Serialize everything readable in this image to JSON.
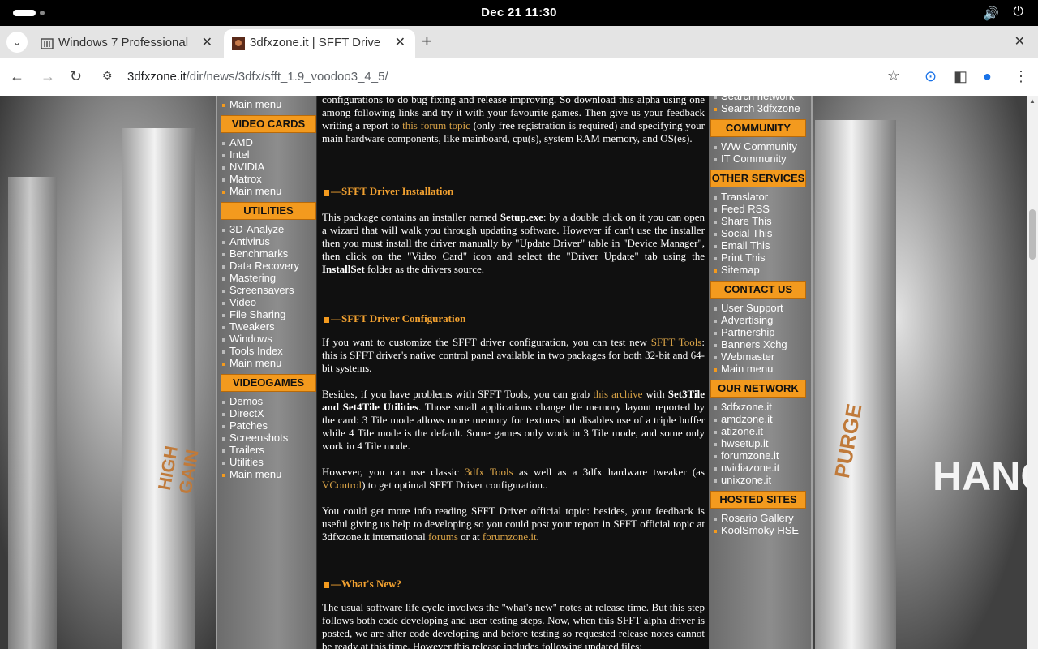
{
  "system": {
    "clock": "Dec 21  11:30",
    "volume_icon": "🔊",
    "power_icon": "⏻"
  },
  "tabs": [
    {
      "title": "Windows 7 Professional",
      "active": false
    },
    {
      "title": "3dfxzone.it | SFFT Driver",
      "active": true
    }
  ],
  "address": {
    "domain": "3dfxzone.it",
    "path": "/dir/news/3dfx/sfft_1.9_voodoo3_4_5/"
  },
  "left_menu": {
    "top_item": "Main menu",
    "sections": [
      {
        "header": "VIDEO CARDS",
        "items": [
          "AMD",
          "Intel",
          "NVIDIA",
          "Matrox",
          "Main menu"
        ]
      },
      {
        "header": "UTILITIES",
        "items": [
          "3D-Analyze",
          "Antivirus",
          "Benchmarks",
          "Data Recovery",
          "Mastering",
          "Screensavers",
          "Video",
          "File Sharing",
          "Tweakers",
          "Windows",
          "Tools Index",
          "Main menu"
        ]
      },
      {
        "header": "VIDEOGAMES",
        "items": [
          "Demos",
          "DirectX",
          "Patches",
          "Screenshots",
          "Trailers",
          "Utilities",
          "Main menu"
        ]
      }
    ]
  },
  "right_menu": {
    "top_items": [
      "Search network",
      "Search 3dfxzone"
    ],
    "sections": [
      {
        "header": "COMMUNITY",
        "items": [
          "WW Community",
          "IT Community"
        ]
      },
      {
        "header": "OTHER SERVICES",
        "items": [
          "Translator",
          "Feed RSS",
          "Share This",
          "Social This",
          "Email This",
          "Print This",
          "Sitemap"
        ]
      },
      {
        "header": "CONTACT US",
        "items": [
          "User Support",
          "Advertising",
          "Partnership",
          "Banners Xchg",
          "Webmaster",
          "Main menu"
        ]
      },
      {
        "header": "OUR NETWORK",
        "items": [
          "3dfxzone.it",
          "amdzone.it",
          "atizone.it",
          "hwsetup.it",
          "forumzone.it",
          "nvidiazone.it",
          "unixzone.it"
        ]
      },
      {
        "header": "HOSTED SITES",
        "items": [
          "Rosario Gallery",
          "KoolSmoky HSE"
        ]
      }
    ]
  },
  "article": {
    "intro_a": "configurations to do bug fixing and release improving. So download this alpha using one among following links and try it with your favourite games. Then give us your feedback writing a report to ",
    "intro_link": "this forum topic",
    "intro_b": " (only free registration is required) and specifying your main hardware components, like mainboard, cpu(s), system RAM memory, and OS(es).",
    "install_title": "SFFT Driver Installation",
    "install_a": "This package contains an installer named ",
    "install_setup": "Setup.exe",
    "install_b": ": by a double click on it you can open a wizard that will walk you through updating software. However if can't use the installer then you must install the driver manually by \"Update Driver\" table in \"Device Manager\", then click on the \"Video Card\" icon and select the \"Driver Update\" tab using the ",
    "install_set": "InstallSet",
    "install_c": " folder as the drivers source.",
    "config_title": "SFFT Driver Configuration",
    "config1_a": "If you want to customize the SFFT driver configuration, you can test new ",
    "config1_link": "SFFT Tools",
    "config1_b": ": this is SFFT driver's native control panel available in two packages for both 32-bit and 64-bit systems.",
    "config2_a": "Besides, if you have problems with SFFT Tools, you can grab ",
    "config2_link": "this archive",
    "config2_b": " with ",
    "config2_bold": "Set3Tile and Set4Tile Utilities",
    "config2_c": ". Those small applications change the memory layout reported by the card: 3 Tile mode allows more memory for textures but disables use of a triple buffer while 4 Tile mode is the default. Some games only work in 3 Tile mode, and some only work in 4 Tile mode.",
    "config3_a": "However, you can use classic ",
    "config3_link1": "3dfx Tools",
    "config3_b": " as well as a 3dfx hardware tweaker (as ",
    "config3_link2": "VControl",
    "config3_c": ") to get optimal SFFT Driver configuration..",
    "config4_a": "You could get more info reading SFFT Driver official topic: besides, your feedback is useful giving us help to developing so you could post your report in SFFT official topic at 3dfxzone.it international ",
    "config4_link1": "forums",
    "config4_b": " or at ",
    "config4_link2": "forumzone.it",
    "config4_c": ".",
    "new_title": "What's New?",
    "new_text": "The usual software life cycle involves the \"what's new\" notes at release time. But this step follows both code developing and user  testing steps. Now, when this SFFT alpha driver is posted, we are after code developing and before testing so requested release notes cannot be ready at this time. However this release includes following updated files:"
  },
  "background": {
    "left_decal": "HIGH GAIN",
    "right_decal": "PURGE",
    "right_sign": "HANG"
  },
  "colors": {
    "accent": "#f39a1e",
    "link": "#d9a347"
  }
}
